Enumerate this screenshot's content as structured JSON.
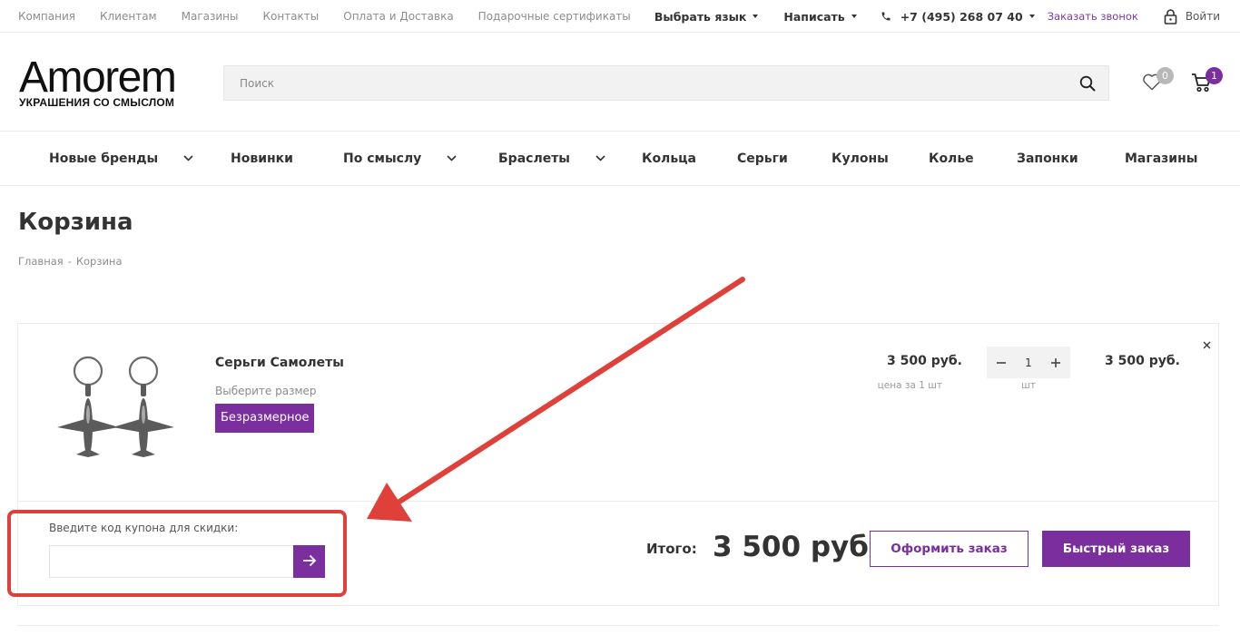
{
  "topbar": {
    "links": [
      "Компания",
      "Клиентам",
      "Магазины",
      "Контакты",
      "Оплата и Доставка",
      "Подарочные сертификаты"
    ],
    "language": "Выбрать язык",
    "write": "Написать",
    "phone": "+7 (495) 268 07 40",
    "callback": "Заказать звонок",
    "login": "Войти"
  },
  "header": {
    "logo_word": "Amorem",
    "logo_tagline": "УКРАШЕНИЯ СО СМЫСЛОМ",
    "search_placeholder": "Поиск",
    "wishlist_count": "0",
    "cart_count": "1"
  },
  "nav": {
    "items": [
      "Новые бренды",
      "Новинки",
      "По смыслу",
      "Браслеты",
      "Кольца",
      "Серьги",
      "Кулоны",
      "Колье",
      "Запонки",
      "Магазины"
    ]
  },
  "page": {
    "title": "Корзина",
    "breadcrumb": [
      "Главная",
      "-",
      "Корзина"
    ]
  },
  "basket": {
    "item": {
      "name": "Серьги Самолеты",
      "size_label": "Выберите размер",
      "size_value": "Безразмерное",
      "unit_price": "3 500 руб.",
      "unit_note": "цена за 1 шт",
      "quantity": "1",
      "quantity_unit": "шт",
      "line_total": "3 500 руб."
    },
    "coupon_label": "Введите код купона для скидки:",
    "coupon_value": "",
    "total_label": "Итого:",
    "total_value": "3 500 руб.",
    "order_button": "Оформить заказ",
    "fast_order_button": "Быстрый заказ"
  },
  "colors": {
    "accent": "#7b2f9e",
    "annotation": "#e0403a"
  }
}
